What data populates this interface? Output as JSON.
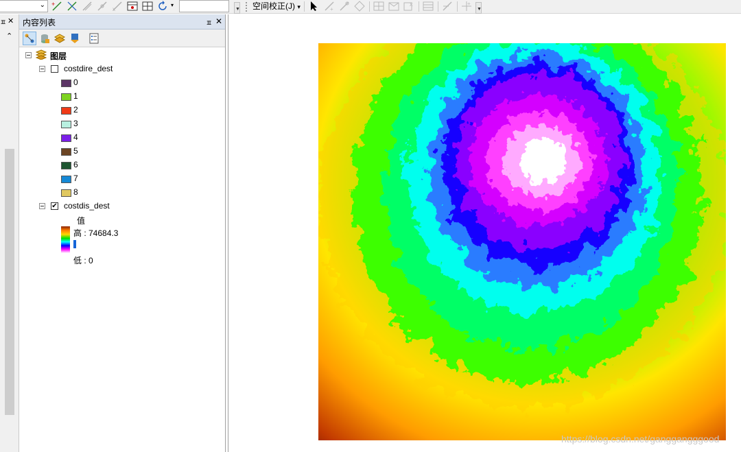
{
  "toolbar": {
    "spatial_adjust_label": "空间校正(J)",
    "spatial_adjust_arrow": "▾",
    "scale_input_value": ""
  },
  "toc": {
    "title": "内容列表",
    "pin_glyph": "ㅍ",
    "close_glyph": "✕",
    "layers_group_label": "图层",
    "layers": [
      {
        "name": "costdire_dest",
        "checked": false,
        "classes": [
          {
            "label": "0",
            "color": "#5c3566"
          },
          {
            "label": "1",
            "color": "#7ed321"
          },
          {
            "label": "2",
            "color": "#f03a17"
          },
          {
            "label": "3",
            "color": "#b8f0e0"
          },
          {
            "label": "4",
            "color": "#7b1fe8"
          },
          {
            "label": "5",
            "color": "#6b4423"
          },
          {
            "label": "6",
            "color": "#1e5631"
          },
          {
            "label": "7",
            "color": "#1589d6"
          },
          {
            "label": "8",
            "color": "#e0c860"
          }
        ]
      },
      {
        "name": "costdis_dest",
        "checked": true,
        "check_glyph": "✔",
        "legend_title": "值",
        "high_label": "高 : 74684.3",
        "low_label": "低 : 0"
      }
    ]
  },
  "left_strip": {
    "pin_glyph": "ㅍ",
    "close_glyph": "✕",
    "scroll_up_glyph": "⌃"
  },
  "watermark": "https://blog.csdn.net/ganggangggood",
  "colors": {
    "toc_header_bg": "#dbe3ef",
    "ramp": [
      "#8b2500",
      "#ff7f00",
      "#ffd700",
      "#00e000",
      "#00ffff",
      "#0000ff",
      "#ff00ff",
      "#ffffff"
    ]
  }
}
